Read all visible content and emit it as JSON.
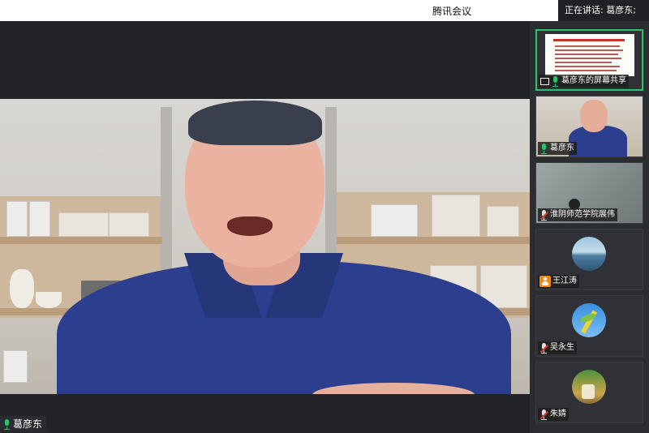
{
  "titlebar": {
    "app_title": "腾讯会议",
    "speaking_prefix": "正在讲话:",
    "speaking_name": "葛彦东;"
  },
  "main_video": {
    "speaker_name": "葛彦东",
    "mic": "mic-on"
  },
  "tiles": [
    {
      "label": "葛彦东的屏幕共享",
      "kind": "screen-share",
      "mic": "mic-on",
      "active": true
    },
    {
      "label": "葛彦东",
      "kind": "video",
      "mic": "mic-on",
      "active": false
    },
    {
      "label": "淮阴师范学院展伟",
      "kind": "video",
      "mic": "mic-muted",
      "active": false
    },
    {
      "label": "王江涛",
      "kind": "avatar",
      "mic": "user-icon",
      "active": false
    },
    {
      "label": "吴永生",
      "kind": "avatar",
      "mic": "mic-muted",
      "active": false
    },
    {
      "label": "朱婧",
      "kind": "avatar",
      "mic": "mic-muted",
      "active": false
    }
  ],
  "colors": {
    "accent": "#27c46b",
    "muted": "#e0382f",
    "shirt": "#2b3f8e",
    "user_badge": "#f08a1c"
  }
}
